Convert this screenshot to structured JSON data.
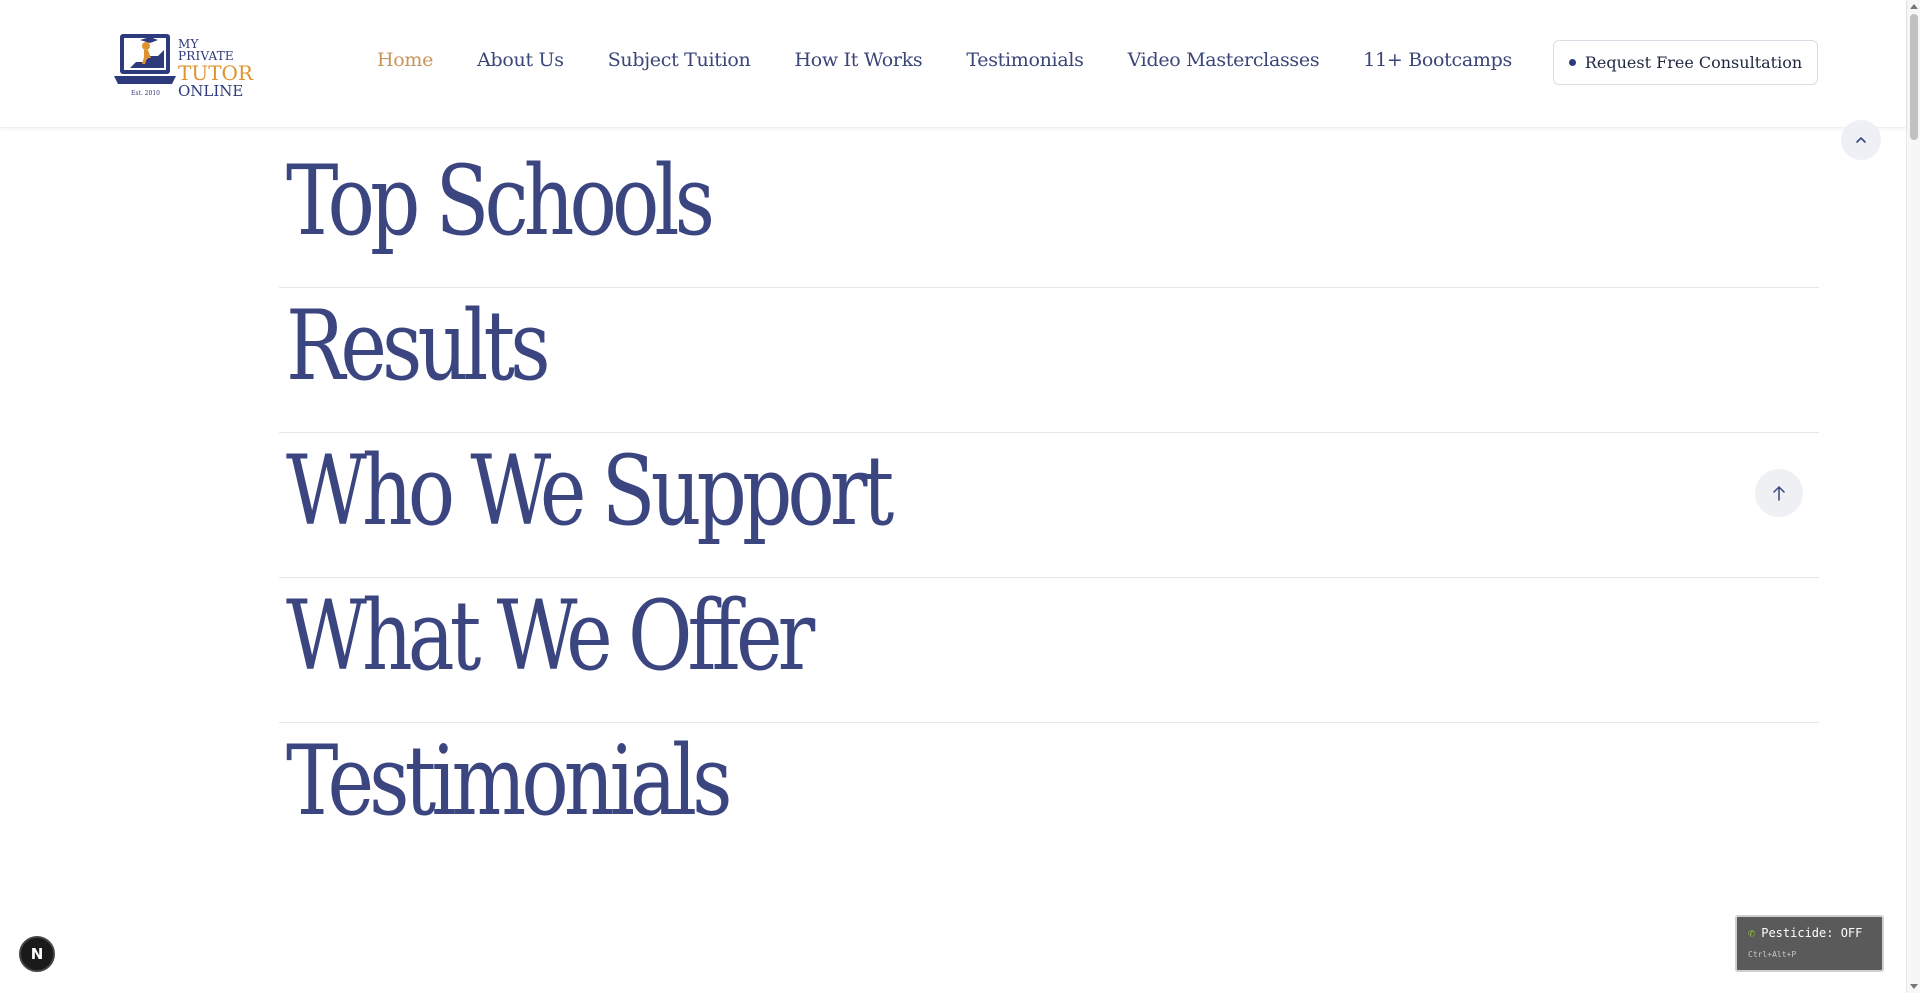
{
  "logo": {
    "line1": "MY PRIVATE",
    "line2": "TUTOR",
    "line3": "ONLINE",
    "est": "Est. 2010"
  },
  "nav": {
    "items": [
      {
        "label": "Home",
        "active": true
      },
      {
        "label": "About Us"
      },
      {
        "label": "Subject Tuition"
      },
      {
        "label": "How It Works"
      },
      {
        "label": "Testimonials"
      },
      {
        "label": "Video Masterclasses"
      },
      {
        "label": "11+ Bootcamps"
      }
    ]
  },
  "cta": {
    "label": "Request Free Consultation"
  },
  "sections": [
    {
      "title": "Top Schools"
    },
    {
      "title": "Results"
    },
    {
      "title": "Who We Support"
    },
    {
      "title": "What We Offer"
    },
    {
      "title": "Testimonials"
    }
  ],
  "next_badge": {
    "label": "N"
  },
  "pesticide": {
    "status": "Pesticide: OFF",
    "shortcut": "Ctrl+Alt+P"
  },
  "colors": {
    "primary": "#3b4681",
    "accent": "#c9965a",
    "logo_orange": "#e0922f"
  }
}
